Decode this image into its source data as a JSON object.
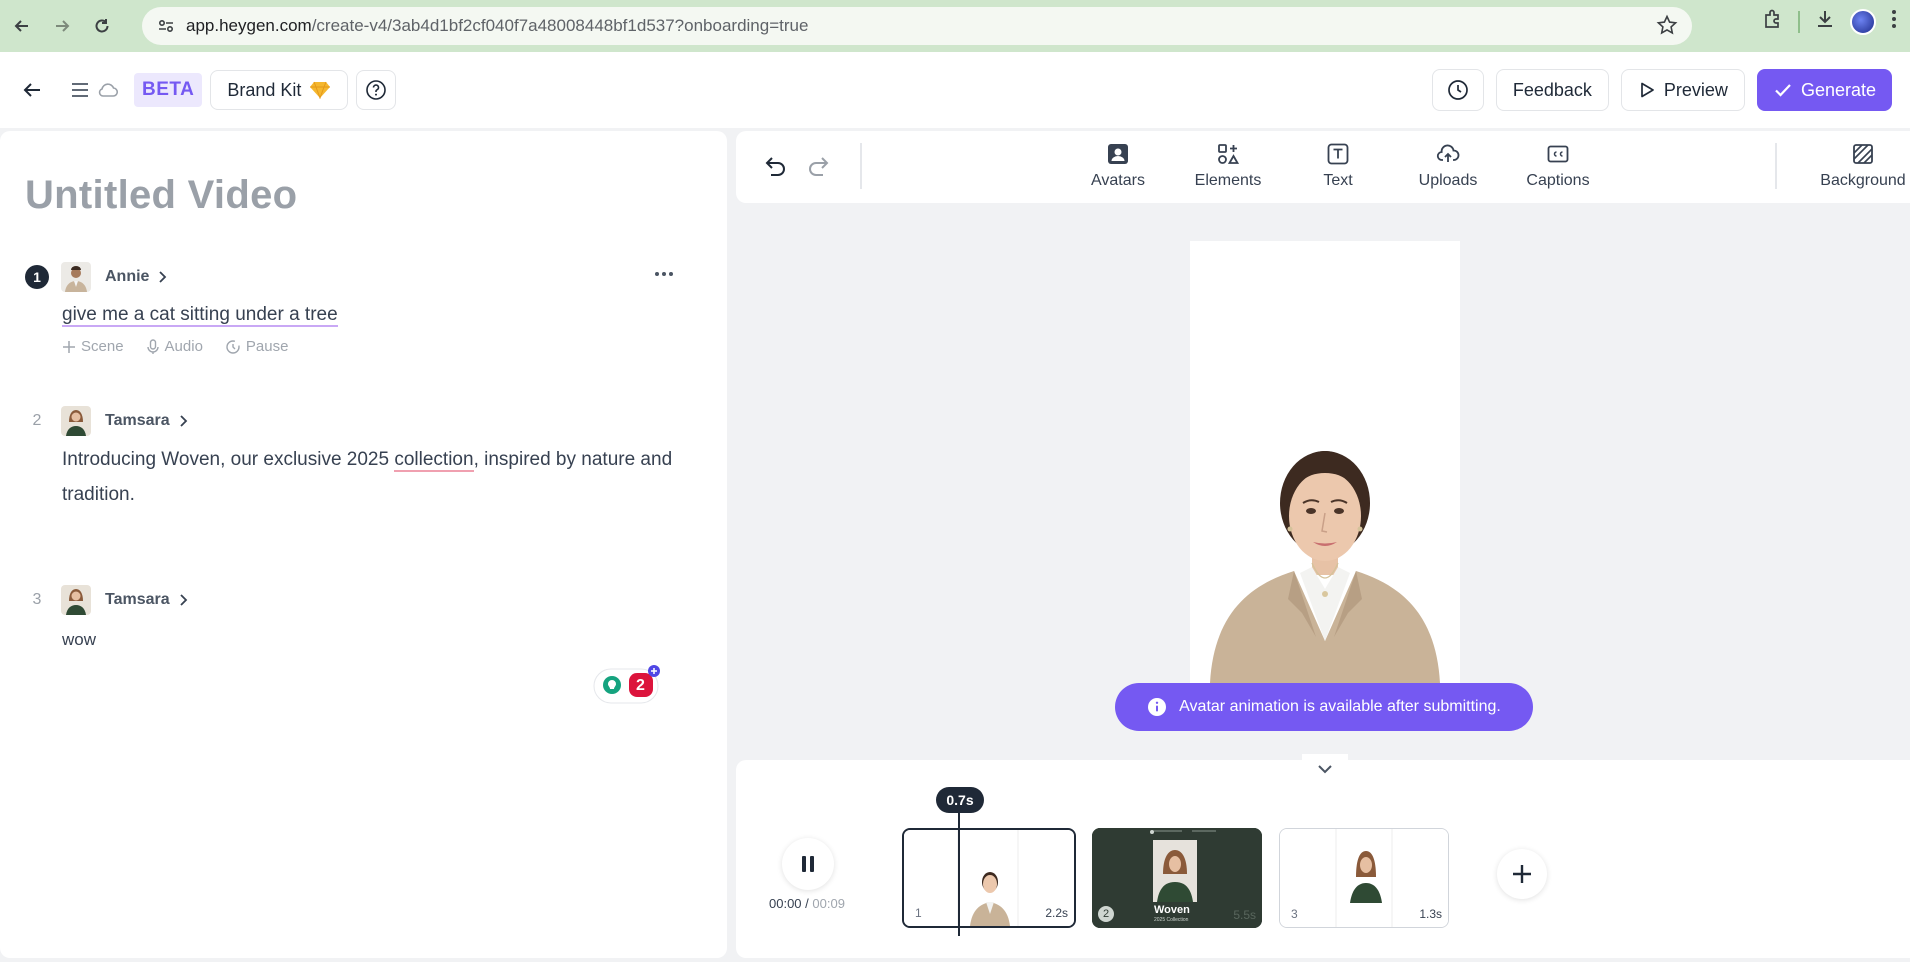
{
  "browser": {
    "url_host": "app.heygen.com",
    "url_path": "/create-v4/3ab4d1bf2cf040f7a48008448bf1d537?onboarding=true"
  },
  "topbar": {
    "beta_label": "BETA",
    "brand_kit_label": "Brand Kit",
    "feedback_label": "Feedback",
    "preview_label": "Preview",
    "generate_label": "Generate",
    "accent_color": "#7559f2"
  },
  "script": {
    "title_placeholder": "Untitled Video",
    "scenes": [
      {
        "number": "1",
        "avatar_name": "Annie",
        "text": "give me a cat sitting under a tree",
        "actions": [
          "Scene",
          "Audio",
          "Pause"
        ]
      },
      {
        "number": "2",
        "avatar_name": "Tamsara",
        "text_a": " Introducing Woven, our exclusive 2025 ",
        "text_b": "collection",
        "text_c": ", inspired by nature and tradition."
      },
      {
        "number": "3",
        "avatar_name": "Tamsara",
        "text": "wow"
      }
    ],
    "grammar_count": "2"
  },
  "toolbar": {
    "tools": [
      "Avatars",
      "Elements",
      "Text",
      "Uploads",
      "Captions"
    ],
    "background_label": "Background"
  },
  "canvas": {
    "toast_text": "Avatar animation is available after submitting."
  },
  "timeline": {
    "current_time": "00:00",
    "total_time": "00:09",
    "playhead_label": "0.7s",
    "clips": [
      {
        "number": "1",
        "duration": "2.2s"
      },
      {
        "number": "2",
        "duration": "5.5s",
        "title": "Woven",
        "subtitle": "2025 Collection"
      },
      {
        "number": "3",
        "duration": "1.3s"
      }
    ]
  }
}
